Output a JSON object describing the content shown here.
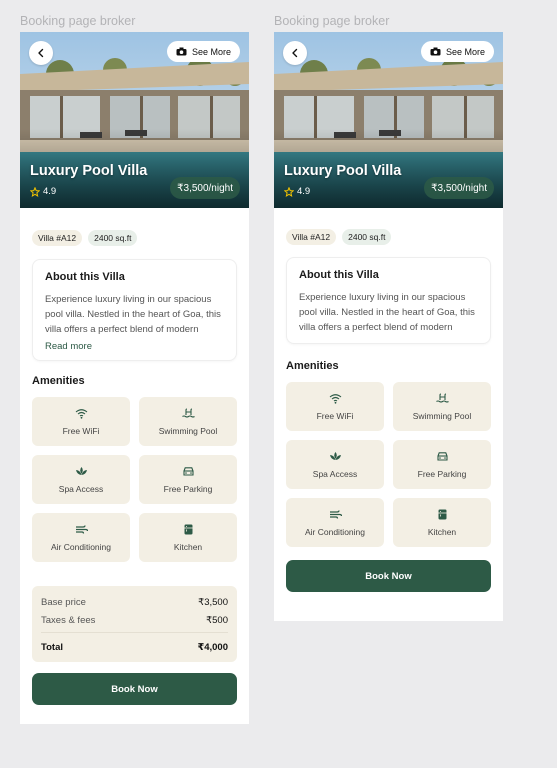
{
  "left": {
    "frame_label": "Booking page broker",
    "see_more": "See More",
    "title": "Luxury Pool Villa",
    "rating": "4.9",
    "price": "₹3,500/night",
    "chips": [
      "Villa #A12",
      "2400 sq.ft"
    ],
    "about": {
      "heading": "About this Villa",
      "text": "Experience luxury living in our spacious pool villa. Nestled in the heart of Goa, this villa offers a perfect blend of modern",
      "read_more": "Read more"
    },
    "amenities_title": "Amenities",
    "amenities": [
      {
        "label": "Free WiFi",
        "icon": "wifi-icon"
      },
      {
        "label": "Swimming Pool",
        "icon": "pool-icon"
      },
      {
        "label": "Spa Access",
        "icon": "lotus-icon"
      },
      {
        "label": "Free Parking",
        "icon": "car-icon"
      },
      {
        "label": "Air Conditioning",
        "icon": "wind-icon"
      },
      {
        "label": "Kitchen",
        "icon": "fridge-icon"
      }
    ],
    "summary": {
      "base_label": "Base price",
      "base_value": "₹3,500",
      "tax_label": "Taxes & fees",
      "tax_value": "₹500",
      "total_label": "Total",
      "total_value": "₹4,000"
    },
    "book": "Book Now"
  },
  "right": {
    "frame_label": "Booking page broker",
    "see_more": "See More",
    "title": "Luxury Pool Villa",
    "rating": "4.9",
    "price": "₹3,500/night",
    "chips": [
      "Villa #A12",
      "2400 sq.ft"
    ],
    "about": {
      "heading": "About this Villa",
      "text": "Experience luxury living in our spacious pool villa. Nestled in the heart of Goa, this villa offers a perfect blend of modern"
    },
    "amenities_title": "Amenities",
    "amenities": [
      {
        "label": "Free WiFi",
        "icon": "wifi-icon"
      },
      {
        "label": "Swimming Pool",
        "icon": "pool-icon"
      },
      {
        "label": "Spa Access",
        "icon": "lotus-icon"
      },
      {
        "label": "Free Parking",
        "icon": "car-icon"
      },
      {
        "label": "Air Conditioning",
        "icon": "wind-icon"
      },
      {
        "label": "Kitchen",
        "icon": "fridge-icon"
      }
    ],
    "book": "Book Now"
  },
  "colors": {
    "brand_green": "#2d5a46",
    "tile_beige": "#f3efe4",
    "star": "#f2c300"
  }
}
